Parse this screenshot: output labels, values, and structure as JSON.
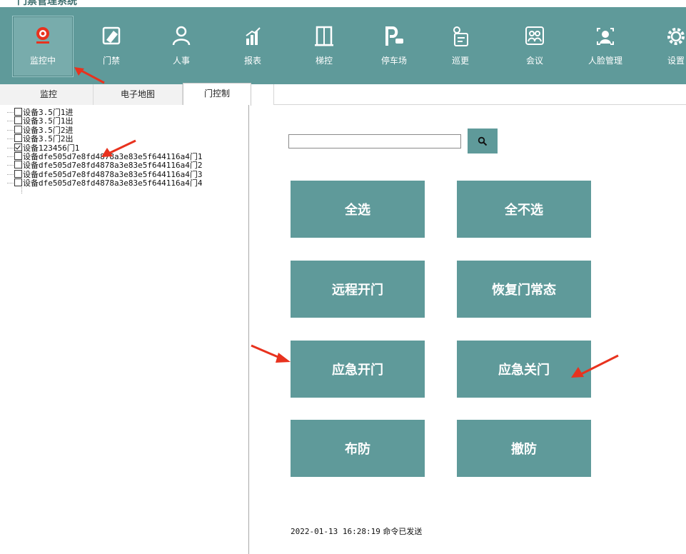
{
  "app": {
    "title": "门禁管理系统"
  },
  "toolbar": {
    "items": [
      {
        "label": "监控中",
        "icon": "camera-icon",
        "active": true
      },
      {
        "label": "门禁",
        "icon": "door-card-icon"
      },
      {
        "label": "人事",
        "icon": "person-icon"
      },
      {
        "label": "报表",
        "icon": "report-chart-icon"
      },
      {
        "label": "梯控",
        "icon": "elevator-icon"
      },
      {
        "label": "停车场",
        "icon": "parking-icon"
      },
      {
        "label": "巡更",
        "icon": "patrol-icon"
      },
      {
        "label": "会议",
        "icon": "meeting-icon"
      },
      {
        "label": "人脸管理",
        "icon": "face-icon"
      },
      {
        "label": "设置",
        "icon": "gear-icon"
      }
    ]
  },
  "tabs": {
    "monitor": "监控",
    "emap": "电子地图",
    "door_control": "门控制"
  },
  "tree": [
    {
      "label": "设备3.5门1进",
      "checked": false
    },
    {
      "label": "设备3.5门1出",
      "checked": false
    },
    {
      "label": "设备3.5门2进",
      "checked": false
    },
    {
      "label": "设备3.5门2出",
      "checked": false
    },
    {
      "label": "设备123456门1",
      "checked": true
    },
    {
      "label": "设备dfe505d7e8fd4878a3e83e5f644116a4门1",
      "checked": false
    },
    {
      "label": "设备dfe505d7e8fd4878a3e83e5f644116a4门2",
      "checked": false
    },
    {
      "label": "设备dfe505d7e8fd4878a3e83e5f644116a4门3",
      "checked": false
    },
    {
      "label": "设备dfe505d7e8fd4878a3e83e5f644116a4门4",
      "checked": false
    }
  ],
  "search": {
    "value": "",
    "icon": "search-icon"
  },
  "actions": {
    "select_all": "全选",
    "select_none": "全不选",
    "remote_open": "远程开门",
    "restore_normal": "恢复门常态",
    "emergency_open": "应急开门",
    "emergency_close": "应急关门",
    "arm": "布防",
    "disarm": "撤防"
  },
  "status": {
    "timestamp": "2022-01-13 16:28:19",
    "message": "命令已发送"
  },
  "colors": {
    "accent": "#5f9a9a",
    "annotation_arrow": "#e8321e"
  }
}
